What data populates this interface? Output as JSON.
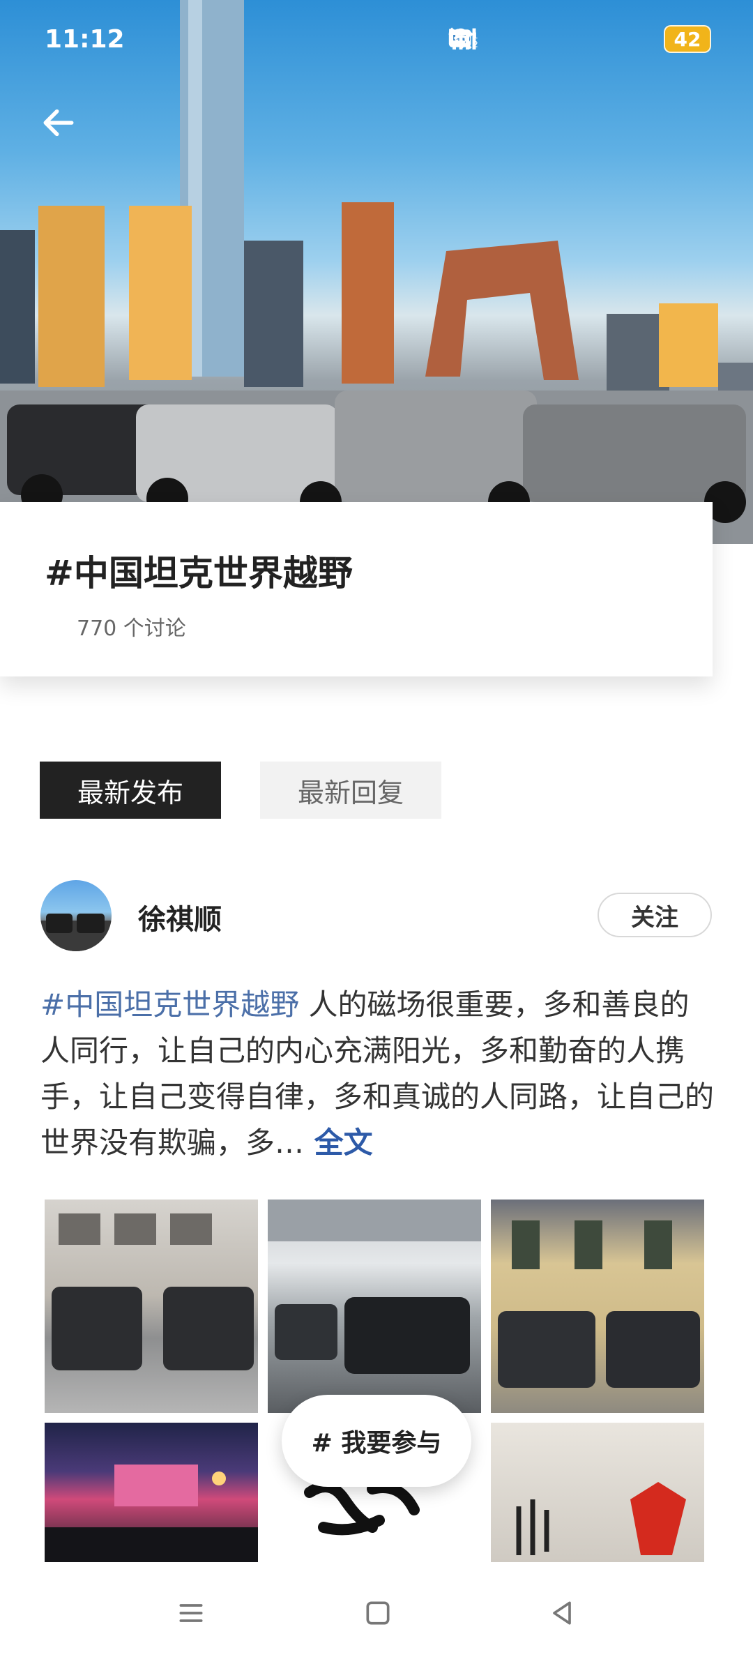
{
  "status_bar": {
    "time": "11:12",
    "battery": "42",
    "icons": [
      "mute-icon",
      "hd-icon",
      "wifi-icon",
      "signal-5g-icon",
      "signal-5g-icon"
    ]
  },
  "header": {
    "back_icon": "arrow-left-icon"
  },
  "topic": {
    "title": "#中国坦克世界越野",
    "discussion_count": "770 个讨论"
  },
  "tabs": [
    {
      "label": "最新发布",
      "active": true
    },
    {
      "label": "最新回复",
      "active": false
    }
  ],
  "post": {
    "username": "徐祺顺",
    "follow_label": "关注",
    "hashtag": "#中国坦克世界越野",
    "body": " 人的磁场很重要，多和善良的人同行，让自己的内心充满阳光，多和勤奋的人携手，让自己变得自律，多和真诚的人同路，让自己的世界没有欺骗，多…",
    "more_label": " 全文"
  },
  "join_button": {
    "label": "# 我要参与"
  },
  "navbar": {
    "icons": [
      "menu-icon",
      "home-icon",
      "back-icon"
    ]
  },
  "colors": {
    "hashtag": "#4b6fa8",
    "active_tab": "#222222",
    "battery": "#f1b41a"
  }
}
